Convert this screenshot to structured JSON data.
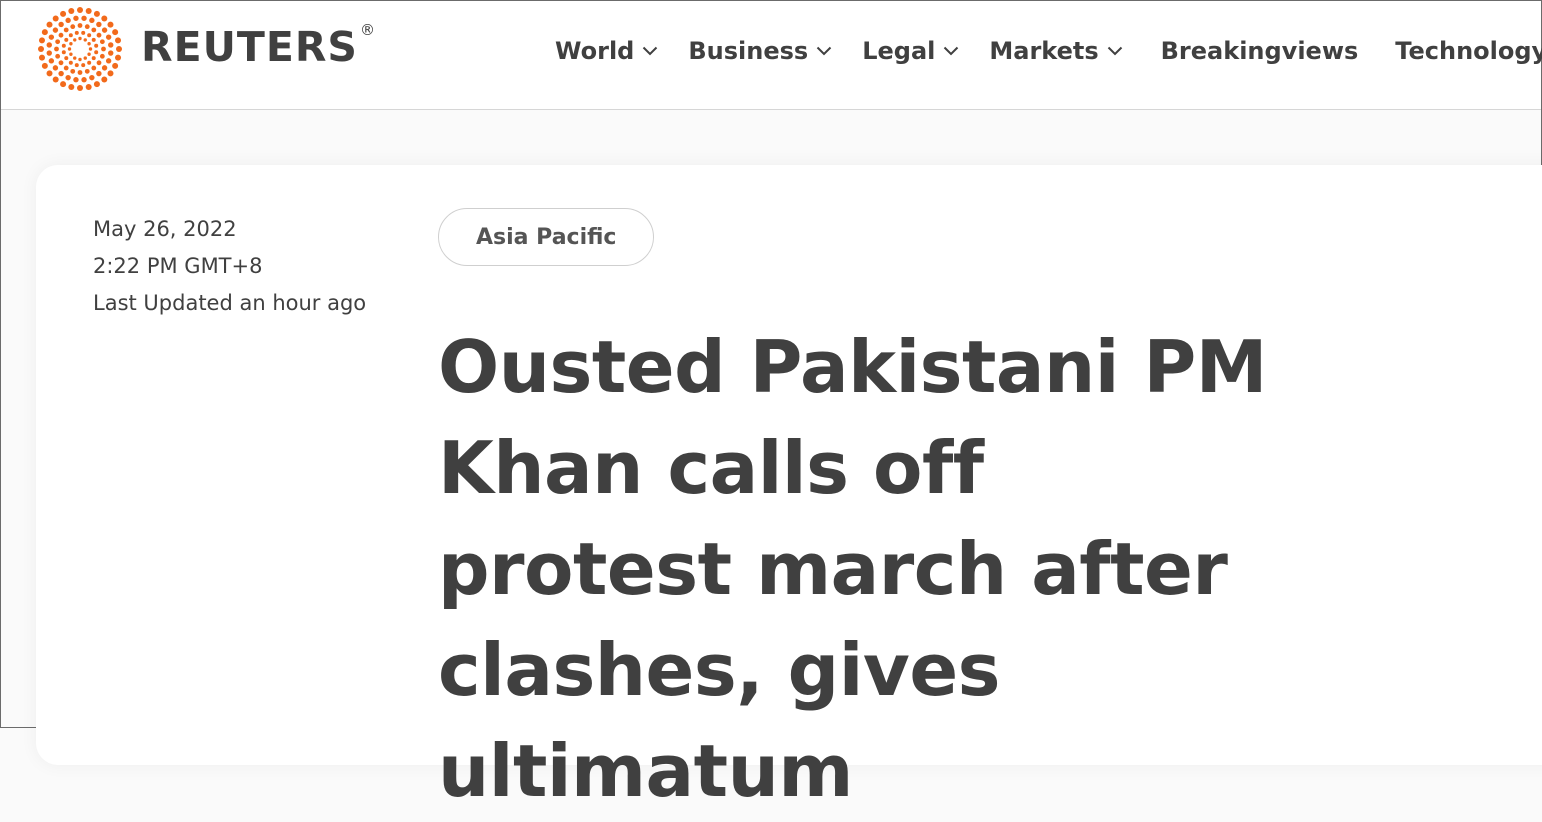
{
  "header": {
    "logo_text": "REUTERS",
    "logo_mark": "®",
    "logo_color": "#f26a1b",
    "nav": [
      {
        "label": "World",
        "has_dropdown": true
      },
      {
        "label": "Business",
        "has_dropdown": true
      },
      {
        "label": "Legal",
        "has_dropdown": true
      },
      {
        "label": "Markets",
        "has_dropdown": true
      },
      {
        "label": "Breakingviews",
        "has_dropdown": false
      },
      {
        "label": "Technology",
        "has_dropdown": true
      }
    ]
  },
  "article": {
    "date": "May 26, 2022",
    "time": "2:22 PM GMT+8",
    "updated": "Last Updated an hour ago",
    "section": "Asia Pacific",
    "headline": "Ousted Pakistani PM Khan calls off protest march after clashes, gives ultimatum"
  }
}
